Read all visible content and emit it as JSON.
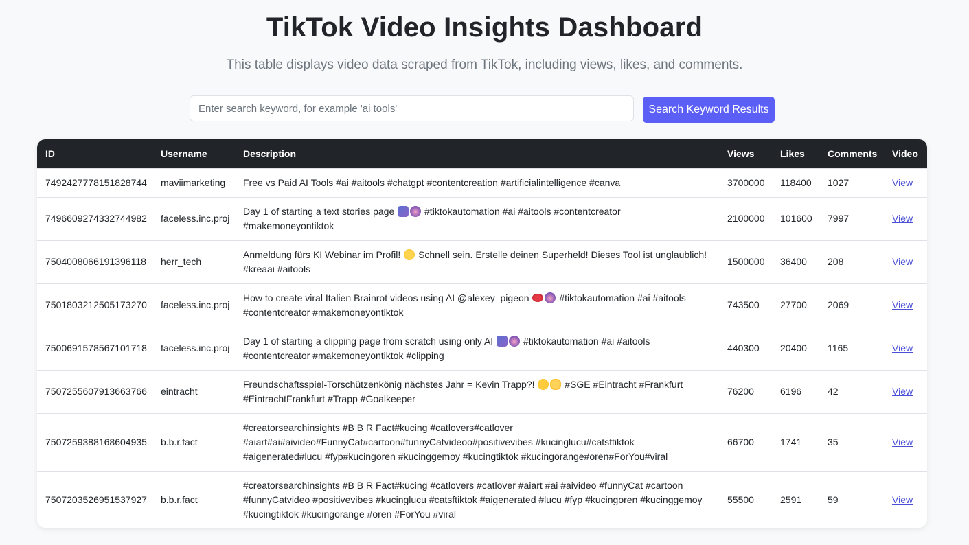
{
  "header": {
    "title": "TikTok Video Insights Dashboard",
    "subtitle": "This table displays video data scraped from TikTok, including views, likes, and comments."
  },
  "search": {
    "placeholder": "Enter search keyword, for example 'ai tools'",
    "value": "",
    "button_label": "Search Keyword Results"
  },
  "table": {
    "columns": [
      "ID",
      "Username",
      "Description",
      "Views",
      "Likes",
      "Comments",
      "Video"
    ],
    "rows": [
      {
        "id": "7492427778151828744",
        "username": "maviimarketing",
        "desc": [
          "Free vs Paid AI Tools #ai #aitools #chatgpt #contentcreation #artificialintelligence #canva"
        ],
        "views": "3700000",
        "likes": "118400",
        "comments": "1027",
        "video": "View"
      },
      {
        "id": "7496609274332744982",
        "username": "faceless.inc.proj",
        "desc": [
          "Day 1 of starting a text stories page",
          "#tiktokautomation #ai #aitools #contentcreator",
          "#makemoneyontiktok"
        ],
        "views": "2100000",
        "likes": "101600",
        "comments": "7997",
        "video": "View"
      },
      {
        "id": "7504008066191396118",
        "username": "herr_tech",
        "desc": [
          "Anmeldung fürs KI Webinar im Profil!",
          "Schnell sein. Erstelle deinen Superheld! Dieses Tool ist unglaublich!",
          "#kreaai #aitools"
        ],
        "views": "1500000",
        "likes": "36400",
        "comments": "208",
        "video": "View"
      },
      {
        "id": "7501803212505173270",
        "username": "faceless.inc.proj",
        "desc": [
          "How to create viral Italien Brainrot videos using AI @alexey_pigeon",
          "#tiktokautomation #ai #aitools",
          "#contentcreator #makemoneyontiktok"
        ],
        "views": "743500",
        "likes": "27700",
        "comments": "2069",
        "video": "View"
      },
      {
        "id": "7500691578567101718",
        "username": "faceless.inc.proj",
        "desc": [
          "Day 1 of starting a clipping page from scratch using only AI",
          "#tiktokautomation #ai #aitools",
          "#contentcreator #makemoneyontiktok #clipping"
        ],
        "views": "440300",
        "likes": "20400",
        "comments": "1165",
        "video": "View"
      },
      {
        "id": "7507255607913663766",
        "username": "eintracht",
        "desc": [
          "Freundschaftsspiel-Torschützenkönig nächstes Jahr = Kevin Trapp?!",
          "#SGE #Eintracht #Frankfurt",
          "#EintrachtFrankfurt #Trapp #Goalkeeper"
        ],
        "views": "76200",
        "likes": "6196",
        "comments": "42",
        "video": "View"
      },
      {
        "id": "7507259388168604935",
        "username": "b.b.r.fact",
        "desc": [
          "#creatorsearchinsights #B B R Fact#kucing #catlovers#catlover",
          "#aiart#ai#aivideo#FunnyCat#cartoon#funnyCatvideoo#positivevibes #kucinglucu#catsftiktok",
          "#aigenerated#lucu #fyp#kucingoren #kucinggemoy #kucingtiktok #kucingorange#oren#ForYou#viral"
        ],
        "views": "66700",
        "likes": "1741",
        "comments": "35",
        "video": "View"
      },
      {
        "id": "7507203526951537927",
        "username": "b.b.r.fact",
        "desc": [
          "#creatorsearchinsights #B B R Fact#kucing #catlovers #catlover #aiart #ai #aivideo #funnyCat #cartoon",
          "#funnyCatvideo #positivevibes #kucinglucu #catsftiktok #aigenerated #lucu #fyp #kucingoren #kucinggemoy",
          "#kucingtiktok #kucingorange #oren #ForYou #viral"
        ],
        "views": "55500",
        "likes": "2591",
        "comments": "59",
        "video": "View"
      }
    ]
  },
  "colors": {
    "header_bg": "#212529",
    "button_bg": "#5b5ff5",
    "link": "#4a4fd6",
    "page_bg": "#f8f9fa"
  },
  "icons": [
    "book-emoji-icon",
    "robot-emoji-icon",
    "zany-face-emoji-icon",
    "lips-emoji-icon",
    "laughing-face-emoji-icon",
    "hand-emoji-icon"
  ]
}
